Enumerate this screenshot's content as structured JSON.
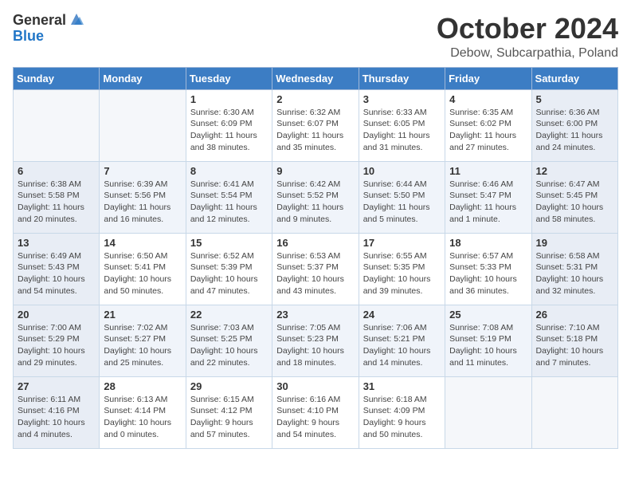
{
  "header": {
    "logo_general": "General",
    "logo_blue": "Blue",
    "month": "October 2024",
    "location": "Debow, Subcarpathia, Poland"
  },
  "days_of_week": [
    "Sunday",
    "Monday",
    "Tuesday",
    "Wednesday",
    "Thursday",
    "Friday",
    "Saturday"
  ],
  "weeks": [
    [
      {
        "day": "",
        "info": ""
      },
      {
        "day": "",
        "info": ""
      },
      {
        "day": "1",
        "info": "Sunrise: 6:30 AM\nSunset: 6:09 PM\nDaylight: 11 hours and 38 minutes."
      },
      {
        "day": "2",
        "info": "Sunrise: 6:32 AM\nSunset: 6:07 PM\nDaylight: 11 hours and 35 minutes."
      },
      {
        "day": "3",
        "info": "Sunrise: 6:33 AM\nSunset: 6:05 PM\nDaylight: 11 hours and 31 minutes."
      },
      {
        "day": "4",
        "info": "Sunrise: 6:35 AM\nSunset: 6:02 PM\nDaylight: 11 hours and 27 minutes."
      },
      {
        "day": "5",
        "info": "Sunrise: 6:36 AM\nSunset: 6:00 PM\nDaylight: 11 hours and 24 minutes."
      }
    ],
    [
      {
        "day": "6",
        "info": "Sunrise: 6:38 AM\nSunset: 5:58 PM\nDaylight: 11 hours and 20 minutes."
      },
      {
        "day": "7",
        "info": "Sunrise: 6:39 AM\nSunset: 5:56 PM\nDaylight: 11 hours and 16 minutes."
      },
      {
        "day": "8",
        "info": "Sunrise: 6:41 AM\nSunset: 5:54 PM\nDaylight: 11 hours and 12 minutes."
      },
      {
        "day": "9",
        "info": "Sunrise: 6:42 AM\nSunset: 5:52 PM\nDaylight: 11 hours and 9 minutes."
      },
      {
        "day": "10",
        "info": "Sunrise: 6:44 AM\nSunset: 5:50 PM\nDaylight: 11 hours and 5 minutes."
      },
      {
        "day": "11",
        "info": "Sunrise: 6:46 AM\nSunset: 5:47 PM\nDaylight: 11 hours and 1 minute."
      },
      {
        "day": "12",
        "info": "Sunrise: 6:47 AM\nSunset: 5:45 PM\nDaylight: 10 hours and 58 minutes."
      }
    ],
    [
      {
        "day": "13",
        "info": "Sunrise: 6:49 AM\nSunset: 5:43 PM\nDaylight: 10 hours and 54 minutes."
      },
      {
        "day": "14",
        "info": "Sunrise: 6:50 AM\nSunset: 5:41 PM\nDaylight: 10 hours and 50 minutes."
      },
      {
        "day": "15",
        "info": "Sunrise: 6:52 AM\nSunset: 5:39 PM\nDaylight: 10 hours and 47 minutes."
      },
      {
        "day": "16",
        "info": "Sunrise: 6:53 AM\nSunset: 5:37 PM\nDaylight: 10 hours and 43 minutes."
      },
      {
        "day": "17",
        "info": "Sunrise: 6:55 AM\nSunset: 5:35 PM\nDaylight: 10 hours and 39 minutes."
      },
      {
        "day": "18",
        "info": "Sunrise: 6:57 AM\nSunset: 5:33 PM\nDaylight: 10 hours and 36 minutes."
      },
      {
        "day": "19",
        "info": "Sunrise: 6:58 AM\nSunset: 5:31 PM\nDaylight: 10 hours and 32 minutes."
      }
    ],
    [
      {
        "day": "20",
        "info": "Sunrise: 7:00 AM\nSunset: 5:29 PM\nDaylight: 10 hours and 29 minutes."
      },
      {
        "day": "21",
        "info": "Sunrise: 7:02 AM\nSunset: 5:27 PM\nDaylight: 10 hours and 25 minutes."
      },
      {
        "day": "22",
        "info": "Sunrise: 7:03 AM\nSunset: 5:25 PM\nDaylight: 10 hours and 22 minutes."
      },
      {
        "day": "23",
        "info": "Sunrise: 7:05 AM\nSunset: 5:23 PM\nDaylight: 10 hours and 18 minutes."
      },
      {
        "day": "24",
        "info": "Sunrise: 7:06 AM\nSunset: 5:21 PM\nDaylight: 10 hours and 14 minutes."
      },
      {
        "day": "25",
        "info": "Sunrise: 7:08 AM\nSunset: 5:19 PM\nDaylight: 10 hours and 11 minutes."
      },
      {
        "day": "26",
        "info": "Sunrise: 7:10 AM\nSunset: 5:18 PM\nDaylight: 10 hours and 7 minutes."
      }
    ],
    [
      {
        "day": "27",
        "info": "Sunrise: 6:11 AM\nSunset: 4:16 PM\nDaylight: 10 hours and 4 minutes."
      },
      {
        "day": "28",
        "info": "Sunrise: 6:13 AM\nSunset: 4:14 PM\nDaylight: 10 hours and 0 minutes."
      },
      {
        "day": "29",
        "info": "Sunrise: 6:15 AM\nSunset: 4:12 PM\nDaylight: 9 hours and 57 minutes."
      },
      {
        "day": "30",
        "info": "Sunrise: 6:16 AM\nSunset: 4:10 PM\nDaylight: 9 hours and 54 minutes."
      },
      {
        "day": "31",
        "info": "Sunrise: 6:18 AM\nSunset: 4:09 PM\nDaylight: 9 hours and 50 minutes."
      },
      {
        "day": "",
        "info": ""
      },
      {
        "day": "",
        "info": ""
      }
    ]
  ]
}
